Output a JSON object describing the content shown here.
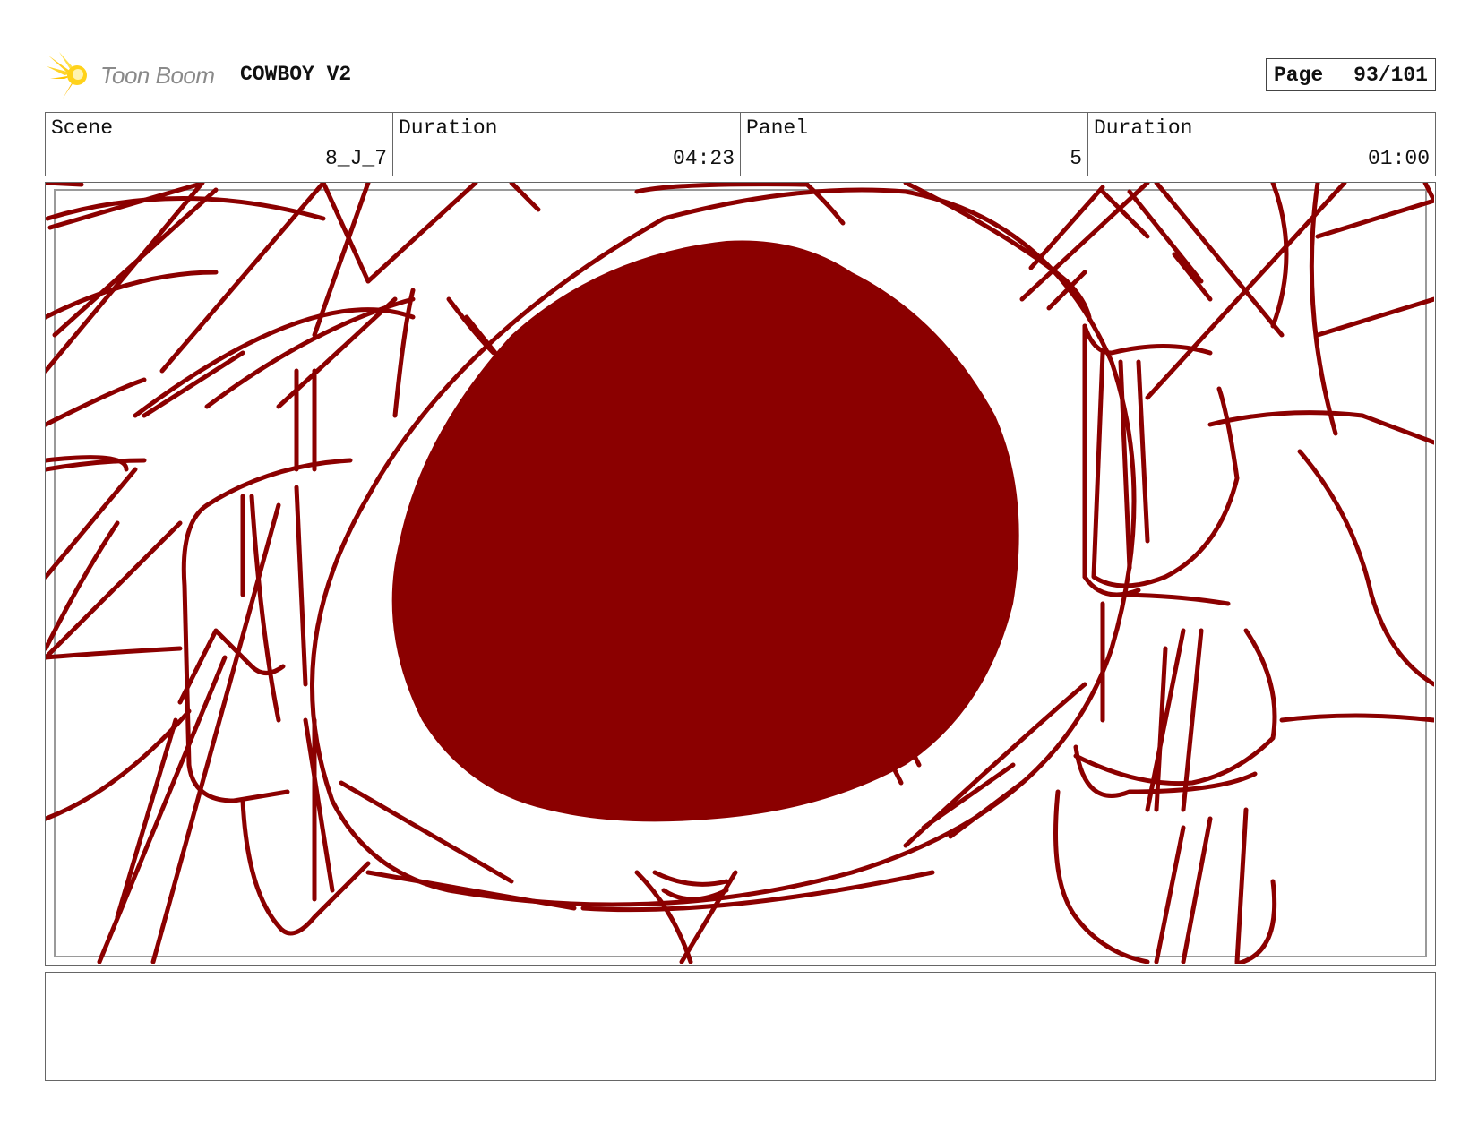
{
  "header": {
    "logo_text": "Toon Boom",
    "logo_icon": "sunburst-logo-icon",
    "project_title": "COWBOY V2",
    "page_label": "Page",
    "page_value": "93/101"
  },
  "info": {
    "scene_label": "Scene",
    "scene_value": "8_J_7",
    "duration_label": "Duration",
    "duration_value": "04:23",
    "panel_label": "Panel",
    "panel_value": "5",
    "panel_duration_label": "Duration",
    "panel_duration_value": "01:00"
  },
  "panel": {
    "sketch_color": "#8b0000"
  },
  "notes": {
    "text": ""
  }
}
